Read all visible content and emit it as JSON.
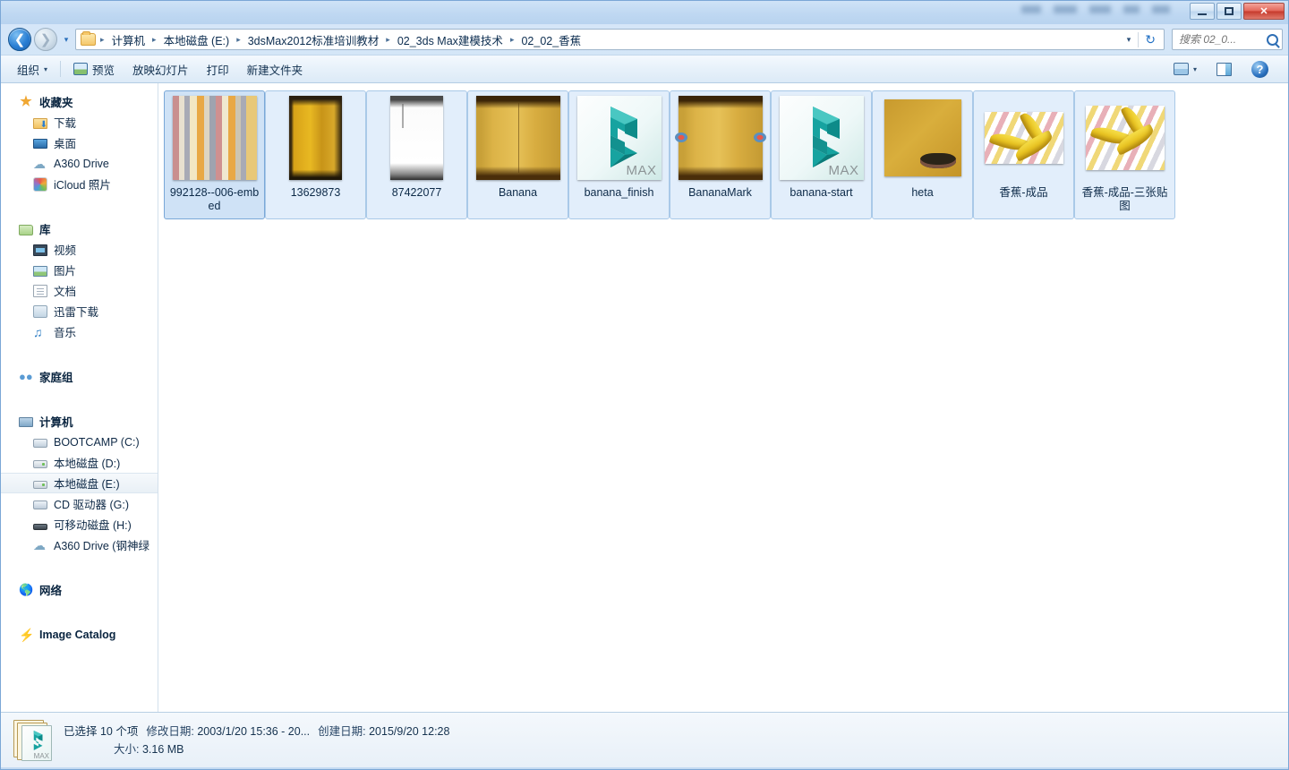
{
  "window": {
    "controls": {
      "minimize": "—",
      "maximize": "□",
      "close": "✕"
    }
  },
  "address": {
    "back_label": "←",
    "forward_label": "→",
    "history_caret": "▾",
    "breadcrumbs": [
      "计算机",
      "本地磁盘 (E:)",
      "3dsMax2012标准培训教材",
      "02_3ds Max建模技术",
      "02_02_香蕉"
    ],
    "separator": "▸",
    "dropdown_caret": "▾",
    "refresh_label": "↻"
  },
  "search": {
    "placeholder": "搜索 02_0...",
    "value": ""
  },
  "toolbar": {
    "organize": "组织",
    "organize_caret": "▾",
    "preview": "预览",
    "slideshow": "放映幻灯片",
    "print": "打印",
    "new_folder": "新建文件夹",
    "view_caret": "▾",
    "help": "?"
  },
  "sidebar": {
    "groups": [
      {
        "header": {
          "label": "收藏夹",
          "icon": "star-icon"
        },
        "items": [
          {
            "label": "下载",
            "icon": "download-folder-icon"
          },
          {
            "label": "桌面",
            "icon": "desktop-icon"
          },
          {
            "label": "A360 Drive",
            "icon": "cloud-icon"
          },
          {
            "label": "iCloud 照片",
            "icon": "icloud-photos-icon"
          }
        ]
      },
      {
        "header": {
          "label": "库",
          "icon": "library-icon"
        },
        "items": [
          {
            "label": "视频",
            "icon": "video-icon"
          },
          {
            "label": "图片",
            "icon": "pictures-icon"
          },
          {
            "label": "文档",
            "icon": "documents-icon"
          },
          {
            "label": "迅雷下载",
            "icon": "xunlei-icon"
          },
          {
            "label": "音乐",
            "icon": "music-icon"
          }
        ]
      },
      {
        "header": {
          "label": "家庭组",
          "icon": "homegroup-icon"
        },
        "items": []
      },
      {
        "header": {
          "label": "计算机",
          "icon": "computer-icon"
        },
        "items": [
          {
            "label": "BOOTCAMP (C:)",
            "icon": "bootcamp-drive-icon"
          },
          {
            "label": "本地磁盘 (D:)",
            "icon": "local-drive-icon"
          },
          {
            "label": "本地磁盘 (E:)",
            "icon": "local-drive-icon",
            "selected": true
          },
          {
            "label": "CD 驱动器 (G:)",
            "icon": "cd-drive-icon"
          },
          {
            "label": "可移动磁盘 (H:)",
            "icon": "usb-drive-icon"
          },
          {
            "label": "A360 Drive (钢神绿",
            "icon": "cloud-icon"
          }
        ]
      },
      {
        "header": {
          "label": "网络",
          "icon": "network-icon"
        },
        "items": []
      },
      {
        "header": {
          "label": "Image Catalog",
          "icon": "image-catalog-icon"
        },
        "items": []
      }
    ]
  },
  "files": [
    {
      "name": "992128--006-embed",
      "thumb": "stripes-texture",
      "selected": "strong"
    },
    {
      "name": "13629873",
      "thumb": "yellow-bark-texture",
      "selected": "light"
    },
    {
      "name": "87422077",
      "thumb": "white-bump-texture",
      "selected": "light"
    },
    {
      "name": "Banana",
      "thumb": "banana-peel-texture",
      "selected": "light"
    },
    {
      "name": "banana_finish",
      "thumb": "max-file-icon",
      "selected": "light"
    },
    {
      "name": "BananaMark",
      "thumb": "banana-mark-texture",
      "selected": "light"
    },
    {
      "name": "banana-start",
      "thumb": "max-file-icon",
      "selected": "light"
    },
    {
      "name": "heta",
      "thumb": "heta-texture",
      "selected": "light"
    },
    {
      "name": "香蕉-成品",
      "thumb": "banana-render",
      "selected": "light"
    },
    {
      "name": "香蕉-成品-三张贴图",
      "thumb": "banana-render-large",
      "selected": "light"
    }
  ],
  "max_icon_label": "MAX",
  "statusbar": {
    "selection": "已选择 10 个项",
    "modified_label": "修改日期:",
    "modified_value": "2003/1/20 15:36 - 20...",
    "created_label": "创建日期:",
    "created_value": "2015/9/20 12:28",
    "size_label": "大小:",
    "size_value": "3.16 MB"
  },
  "colors": {
    "accent": "#2a7fd4",
    "selection_strong": "#cfe2f6",
    "selection_light": "#e2eefb",
    "max_teal": "#1fa6a0"
  }
}
